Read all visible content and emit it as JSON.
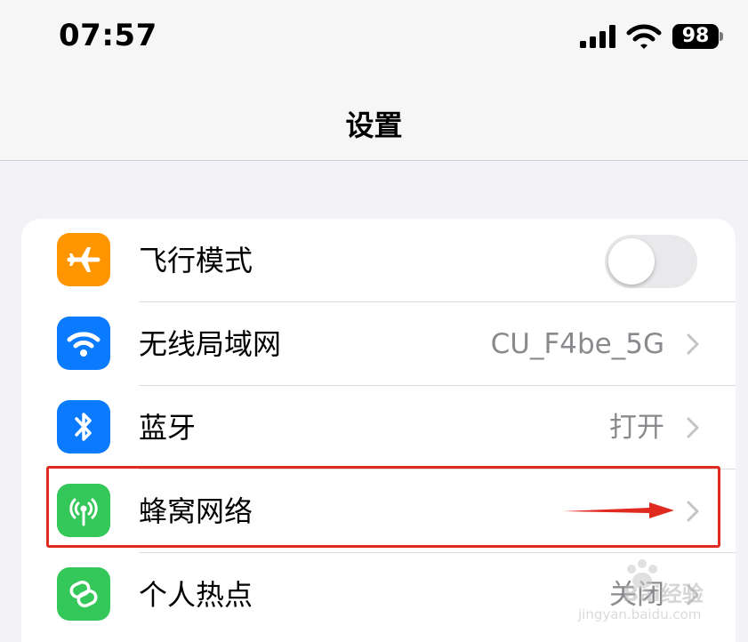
{
  "status_bar": {
    "time": "07:57",
    "battery": "98"
  },
  "nav": {
    "title": "设置"
  },
  "rows": [
    {
      "label": "飞行模式",
      "value": "",
      "icon": "airplane-icon",
      "icon_color": "#ff9500",
      "control": "toggle",
      "toggle_on": false
    },
    {
      "label": "无线局域网",
      "value": "CU_F4be_5G",
      "icon": "wifi-icon",
      "icon_color": "#0a7aff",
      "control": "chevron"
    },
    {
      "label": "蓝牙",
      "value": "打开",
      "icon": "bluetooth-icon",
      "icon_color": "#0a7aff",
      "control": "chevron"
    },
    {
      "label": "蜂窝网络",
      "value": "",
      "icon": "cellular-antenna-icon",
      "icon_color": "#34c759",
      "control": "chevron"
    },
    {
      "label": "个人热点",
      "value": "关闭",
      "icon": "hotspot-link-icon",
      "icon_color": "#34c759",
      "control": "chevron"
    }
  ],
  "annotation": {
    "highlight_color": "#e02a20"
  },
  "watermark": {
    "text": "Bai经验",
    "url": "jingyan.baidu.com"
  }
}
